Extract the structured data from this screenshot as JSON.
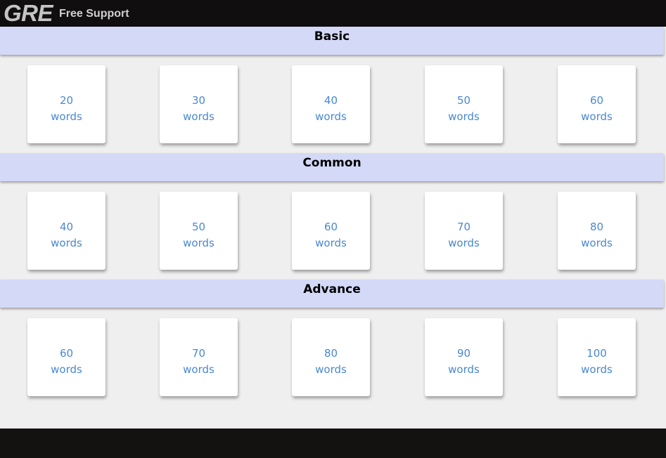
{
  "header": {
    "logo": "GRE",
    "subtitle": "Free Support"
  },
  "sections": [
    {
      "title": "Basic",
      "cards": [
        {
          "count": "20",
          "unit": "words"
        },
        {
          "count": "30",
          "unit": "words"
        },
        {
          "count": "40",
          "unit": "words"
        },
        {
          "count": "50",
          "unit": "words"
        },
        {
          "count": "60",
          "unit": "words"
        }
      ]
    },
    {
      "title": "Common",
      "cards": [
        {
          "count": "40",
          "unit": "words"
        },
        {
          "count": "50",
          "unit": "words"
        },
        {
          "count": "60",
          "unit": "words"
        },
        {
          "count": "70",
          "unit": "words"
        },
        {
          "count": "80",
          "unit": "words"
        }
      ]
    },
    {
      "title": "Advance",
      "cards": [
        {
          "count": "60",
          "unit": "words"
        },
        {
          "count": "70",
          "unit": "words"
        },
        {
          "count": "80",
          "unit": "words"
        },
        {
          "count": "90",
          "unit": "words"
        },
        {
          "count": "100",
          "unit": "words"
        }
      ]
    }
  ],
  "colors": {
    "header_bg": "#d3d9f7",
    "card_text": "#4a88d0",
    "topbar_bg": "#100e0e"
  }
}
